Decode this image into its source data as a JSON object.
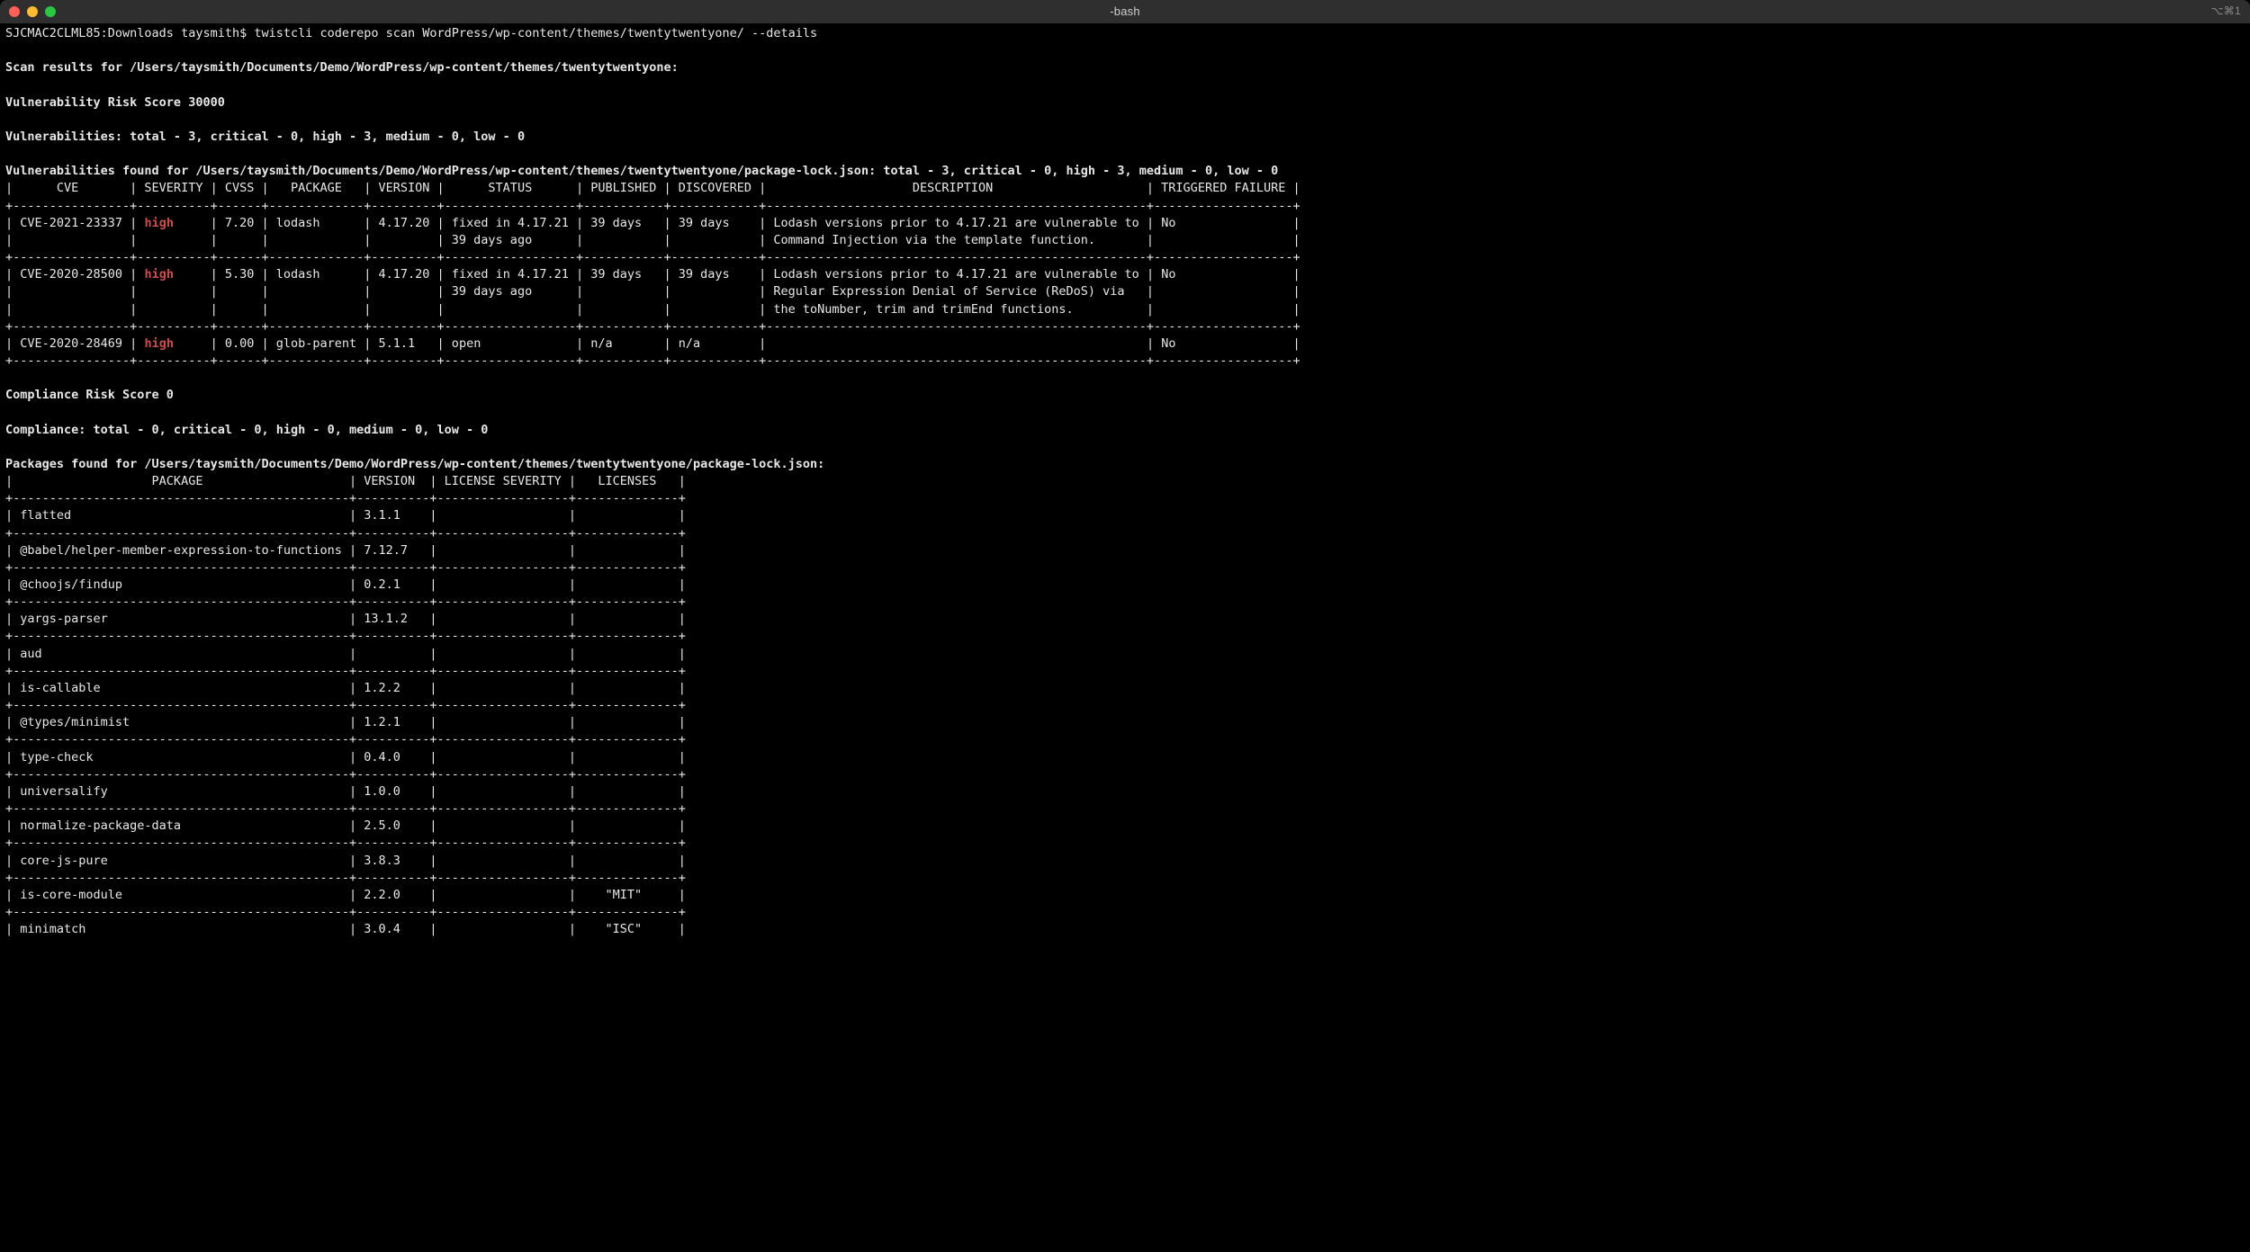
{
  "window": {
    "title": "-bash",
    "right_indicator": "⌥⌘1"
  },
  "prompt": {
    "host": "SJCMAC2CLML85",
    "dir": "Downloads",
    "user": "taysmith",
    "command": "twistcli coderepo scan WordPress/wp-content/themes/twentytwentyone/ --details"
  },
  "scan": {
    "results_for_label": "Scan results for",
    "results_path": "/Users/taysmith/Documents/Demo/WordPress/wp-content/themes/twentytwentyone",
    "vuln_risk_score_label": "Vulnerability Risk Score",
    "vuln_risk_score": "30000",
    "vuln_summary_label": "Vulnerabilities",
    "vuln_summary": {
      "total": "3",
      "critical": "0",
      "high": "3",
      "medium": "0",
      "low": "0"
    },
    "vuln_found_for_label": "Vulnerabilities found for",
    "vuln_found_path": "/Users/taysmith/Documents/Demo/WordPress/wp-content/themes/twentytwentyone/package-lock.json",
    "compliance_risk_score_label": "Compliance Risk Score",
    "compliance_risk_score": "0",
    "compliance_summary_label": "Compliance",
    "compliance_summary": {
      "total": "0",
      "critical": "0",
      "high": "0",
      "medium": "0",
      "low": "0"
    },
    "packages_found_for_label": "Packages found for",
    "packages_found_path": "/Users/taysmith/Documents/Demo/WordPress/wp-content/themes/twentytwentyone/package-lock.json"
  },
  "vuln_table": {
    "headers": {
      "cve": "CVE",
      "severity": "SEVERITY",
      "cvss": "CVSS",
      "package": "PACKAGE",
      "version": "VERSION",
      "status": "STATUS",
      "published": "PUBLISHED",
      "discovered": "DISCOVERED",
      "description": "DESCRIPTION",
      "triggered_failure": "TRIGGERED FAILURE"
    },
    "rows": [
      {
        "cve": "CVE-2021-23337",
        "severity": "high",
        "cvss": "7.20",
        "package": "lodash",
        "version": "4.17.20",
        "status_l1": "fixed in 4.17.21",
        "status_l2": "39 days ago",
        "published": "39 days",
        "discovered": "39 days",
        "desc_l1": "Lodash versions prior to 4.17.21 are vulnerable to",
        "desc_l2": "Command Injection via the template function.",
        "desc_l3": "",
        "triggered_failure": "No"
      },
      {
        "cve": "CVE-2020-28500",
        "severity": "high",
        "cvss": "5.30",
        "package": "lodash",
        "version": "4.17.20",
        "status_l1": "fixed in 4.17.21",
        "status_l2": "39 days ago",
        "published": "39 days",
        "discovered": "39 days",
        "desc_l1": "Lodash versions prior to 4.17.21 are vulnerable to",
        "desc_l2": "Regular Expression Denial of Service (ReDoS) via",
        "desc_l3": "the toNumber, trim and trimEnd functions.",
        "triggered_failure": "No"
      },
      {
        "cve": "CVE-2020-28469",
        "severity": "high",
        "cvss": "0.00",
        "package": "glob-parent",
        "version": "5.1.1",
        "status_l1": "open",
        "status_l2": "",
        "published": "n/a",
        "discovered": "n/a",
        "desc_l1": "",
        "desc_l2": "",
        "desc_l3": "",
        "triggered_failure": "No"
      }
    ]
  },
  "pkg_table": {
    "headers": {
      "package": "PACKAGE",
      "version": "VERSION",
      "license_severity": "LICENSE SEVERITY",
      "licenses": "LICENSES"
    },
    "rows": [
      {
        "package": "flatted",
        "version": "3.1.1",
        "license_severity": "",
        "licenses": ""
      },
      {
        "package": "@babel/helper-member-expression-to-functions",
        "version": "7.12.7",
        "license_severity": "",
        "licenses": ""
      },
      {
        "package": "@choojs/findup",
        "version": "0.2.1",
        "license_severity": "",
        "licenses": ""
      },
      {
        "package": "yargs-parser",
        "version": "13.1.2",
        "license_severity": "",
        "licenses": ""
      },
      {
        "package": "aud",
        "version": "",
        "license_severity": "",
        "licenses": ""
      },
      {
        "package": "is-callable",
        "version": "1.2.2",
        "license_severity": "",
        "licenses": ""
      },
      {
        "package": "@types/minimist",
        "version": "1.2.1",
        "license_severity": "",
        "licenses": ""
      },
      {
        "package": "type-check",
        "version": "0.4.0",
        "license_severity": "",
        "licenses": ""
      },
      {
        "package": "universalify",
        "version": "1.0.0",
        "license_severity": "",
        "licenses": ""
      },
      {
        "package": "normalize-package-data",
        "version": "2.5.0",
        "license_severity": "",
        "licenses": ""
      },
      {
        "package": "core-js-pure",
        "version": "3.8.3",
        "license_severity": "",
        "licenses": ""
      },
      {
        "package": "is-core-module",
        "version": "2.2.0",
        "license_severity": "",
        "licenses": "\"MIT\""
      },
      {
        "package": "minimatch",
        "version": "3.0.4",
        "license_severity": "",
        "licenses": "\"ISC\""
      }
    ]
  }
}
